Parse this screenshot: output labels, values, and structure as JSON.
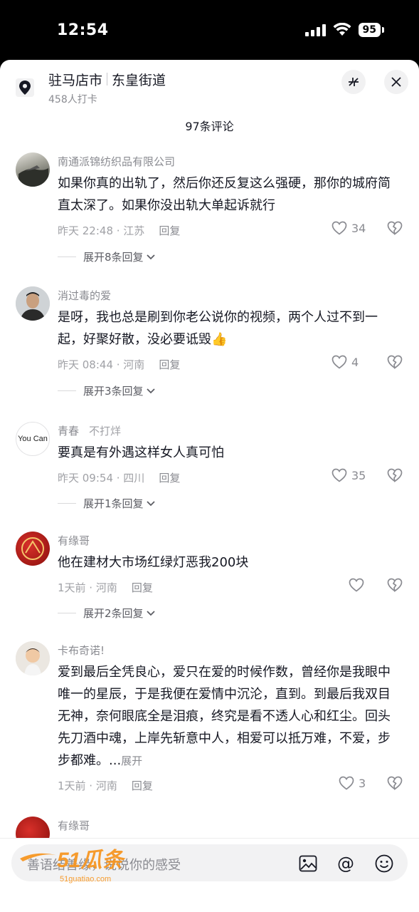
{
  "status_bar": {
    "time": "12:54",
    "battery": "95"
  },
  "header": {
    "location_primary": "驻马店市",
    "location_secondary": "东皇街道",
    "checkins": "458人打卡",
    "comment_count": "97条评论"
  },
  "comments": [
    {
      "name": "南通派锦纺织品有限公司",
      "text": "如果你真的出轨了，然后你还反复这么强硬，那你的城府简直太深了。如果你没出轨大单起诉就行",
      "meta": "昨天 22:48 · 江苏",
      "reply": "回复",
      "likes": "34",
      "expand": "展开8条回复"
    },
    {
      "name": "消过毒的爱",
      "text": "是呀，我也总是刷到你老公说你的视频，两个人过不到一起，好聚好散，没必要诋毁👍",
      "meta": "昨天 08:44 · 河南",
      "reply": "回复",
      "likes": "4",
      "expand": "展开3条回复"
    },
    {
      "name": "青春",
      "tag": "不打烊",
      "avatar_text": "You Can",
      "text": "要真是有外遇这样女人真可怕",
      "meta": "昨天 09:54 · 四川",
      "reply": "回复",
      "likes": "35",
      "expand": "展开1条回复"
    },
    {
      "name": "有缘哥",
      "text": "他在建材大市场红绿灯恶我200块",
      "meta": "1天前 · 河南",
      "reply": "回复",
      "likes": "",
      "expand": "展开2条回复"
    },
    {
      "name": "卡布奇诺!",
      "text": "爱到最后全凭良心，爱只在爱的时候作数，曾经你是我眼中唯一的星辰，于是我便在爱情中沉沦，直到。到最后我双目无神，奈何眼底全是泪痕，终究是看不透人心和红尘。回头先刀酒中魂，上岸先斩意中人，相爱可以抵万难，不爱，步步都难。...",
      "more": "展开",
      "meta": "1天前 · 河南",
      "reply": "回复",
      "likes": "3"
    },
    {
      "name": "有缘哥"
    }
  ],
  "composer": {
    "placeholder": "善语结善缘，说说你的感受",
    "watermark": "51瓜条",
    "watermark_url": "51guatiao.com"
  },
  "colors": {
    "accent_red": "#fe2c55",
    "text_primary": "#161823",
    "text_secondary": "#8a8b91"
  }
}
